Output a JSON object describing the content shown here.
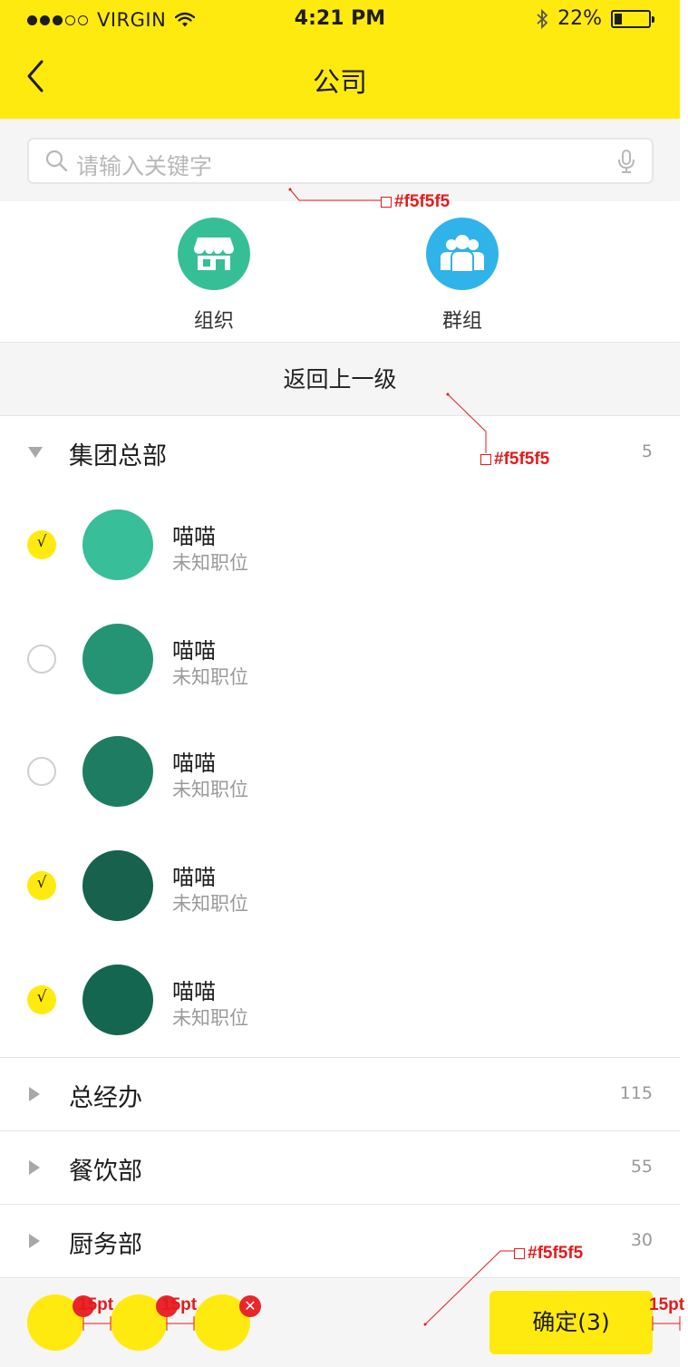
{
  "status_bar": {
    "carrier": "VIRGIN",
    "time": "4:21 PM",
    "battery": "22%",
    "battery_level": 0.22
  },
  "nav": {
    "title": "公司"
  },
  "search": {
    "placeholder": "请输入关键字"
  },
  "entries": [
    {
      "label": "组织",
      "icon": "store-icon",
      "color": "#36bf97"
    },
    {
      "label": "群组",
      "icon": "group-icon",
      "color": "#30b3e8"
    }
  ],
  "back_level": "返回上一级",
  "departments": [
    {
      "name": "集团总部",
      "count": "5",
      "expanded": true
    },
    {
      "name": "总经办",
      "count": "115",
      "expanded": false
    },
    {
      "name": "餐饮部",
      "count": "55",
      "expanded": false
    },
    {
      "name": "厨务部",
      "count": "30",
      "expanded": false
    }
  ],
  "members": [
    {
      "name": "喵喵",
      "title": "未知职位",
      "checked": true,
      "check_mark": "√",
      "avatar_color": "#38be98"
    },
    {
      "name": "喵喵",
      "title": "未知职位",
      "checked": false,
      "check_mark": "",
      "avatar_color": "#249475"
    },
    {
      "name": "喵喵",
      "title": "未知职位",
      "checked": false,
      "check_mark": "",
      "avatar_color": "#1d7c62"
    },
    {
      "name": "喵喵",
      "title": "未知职位",
      "checked": true,
      "check_mark": "√",
      "avatar_color": "#17614d"
    },
    {
      "name": "喵喵",
      "title": "未知职位",
      "checked": true,
      "check_mark": "√",
      "avatar_color": "#146650"
    }
  ],
  "bottom": {
    "confirm_label": "确定(3)",
    "selected_count": 3
  },
  "annotations": {
    "color_search": "#f5f5f5",
    "color_back_level": "#f5f5f5",
    "color_bottom": "#f5f5f5",
    "spacing_1": "15pt",
    "spacing_2": "15pt",
    "spacing_3": "15pt"
  },
  "colors": {
    "accent": "#ffea0f",
    "background_gray": "#f5f5f5",
    "annotation_red": "#e41b1b"
  }
}
